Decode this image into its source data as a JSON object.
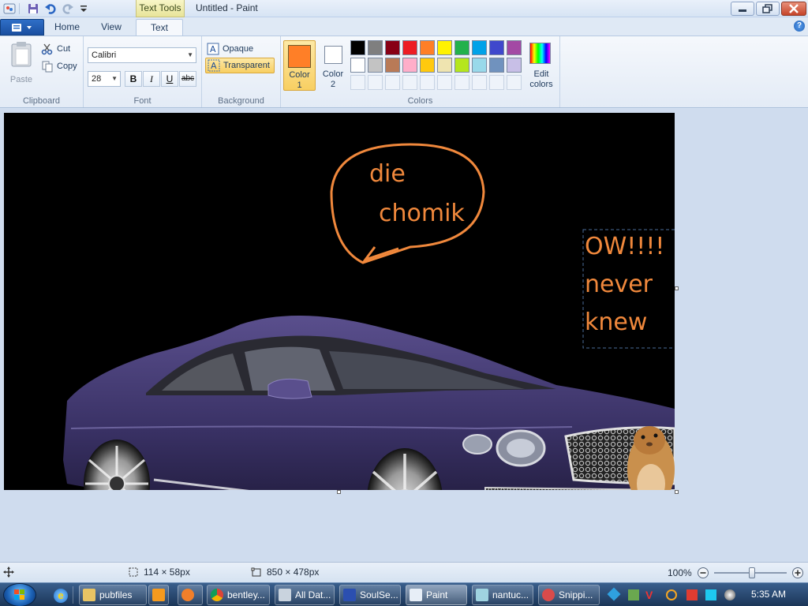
{
  "window": {
    "title": "Untitled - Paint",
    "context_tab": "Text Tools"
  },
  "tabs": [
    {
      "label": "Home"
    },
    {
      "label": "View"
    },
    {
      "label": "Text"
    }
  ],
  "clipboard": {
    "paste": "Paste",
    "cut": "Cut",
    "copy": "Copy",
    "group_label": "Clipboard"
  },
  "font": {
    "family": "Calibri",
    "size": "28",
    "bold": "B",
    "italic": "I",
    "underline": "U",
    "strike": "abc",
    "group_label": "Font"
  },
  "background": {
    "opaque": "Opaque",
    "transparent": "Transparent",
    "group_label": "Background"
  },
  "colors": {
    "color1_label": "Color",
    "color1_num": "1",
    "color2_label": "Color",
    "color2_num": "2",
    "color1_value": "#ff7f27",
    "color2_value": "#ffffff",
    "edit_label": "Edit",
    "edit_label2": "colors",
    "group_label": "Colors",
    "row1": [
      "#000000",
      "#7f7f7f",
      "#880015",
      "#ed1c24",
      "#ff7f27",
      "#fff200",
      "#22b14c",
      "#00a2e8",
      "#3f48cc",
      "#a349a4"
    ],
    "row2": [
      "#ffffff",
      "#c3c3c3",
      "#b97a57",
      "#ffaec9",
      "#ffc90e",
      "#efe4b0",
      "#b5e61d",
      "#99d9ea",
      "#7092be",
      "#c8bfe7"
    ]
  },
  "canvas": {
    "bubble_line1": "die",
    "bubble_line2": "chomik",
    "text_line1": "OW!!!!",
    "text_line2": "never",
    "text_line3": "knew"
  },
  "status": {
    "selection_size": "114 × 58px",
    "canvas_size": "850 × 478px",
    "zoom": "100%"
  },
  "taskbar": {
    "items": [
      "pubfiles",
      "bentley...",
      "All Dat...",
      "SoulSe...",
      "Paint",
      "nantuc...",
      "Snippi..."
    ],
    "clock": "5:35 AM"
  }
}
